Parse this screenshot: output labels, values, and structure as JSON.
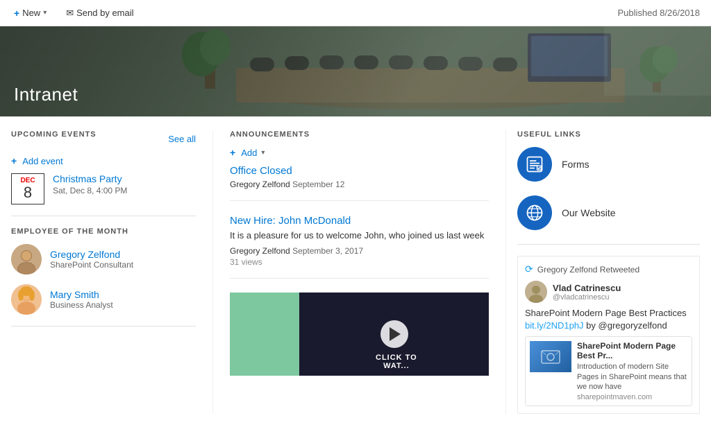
{
  "toolbar": {
    "new_label": "New",
    "send_email_label": "Send by email",
    "published_label": "Published 8/26/2018"
  },
  "hero": {
    "title": "Intranet"
  },
  "upcoming_events": {
    "section_title": "UPCOMING EVENTS",
    "see_all_label": "See all",
    "add_event_label": "+ Add event",
    "events": [
      {
        "month": "DEC",
        "day": "8",
        "name": "Christmas Party",
        "time": "Sat, Dec 8, 4:00 PM"
      }
    ]
  },
  "employee_of_month": {
    "section_title": "EMPLOYEE OF THE MONTH",
    "employees": [
      {
        "name": "Gregory Zelfond",
        "title": "SharePoint Consultant",
        "avatar": "gregory"
      },
      {
        "name": "Mary Smith",
        "title": "Business Analyst",
        "avatar": "mary"
      }
    ]
  },
  "announcements": {
    "section_title": "ANNOUNCEMENTS",
    "add_label": "Add",
    "items": [
      {
        "title": "Office Closed",
        "body": "",
        "author": "Gregory Zelfond",
        "date": "September 12",
        "views": ""
      },
      {
        "title": "New Hire: John McDonald",
        "body": "It is a pleasure for us to welcome John, who joined us last week",
        "author": "Gregory Zelfond",
        "date": "September 3, 2017",
        "views": "31 views"
      }
    ]
  },
  "useful_links": {
    "section_title": "USEFUL LINKS",
    "links": [
      {
        "label": "Forms",
        "icon": "forms"
      },
      {
        "label": "Our Website",
        "icon": "globe"
      }
    ]
  },
  "twitter": {
    "retweeted_by": "Gregory Zelfond Retweeted",
    "user_name": "Vlad Catrinescu",
    "user_handle": "@vladcatrinescu",
    "tweet_text": "SharePoint Modern Page Best Practices",
    "tweet_link": "bit.ly/2ND1phJ",
    "tweet_by": "by @gregoryzelfond",
    "card_title": "SharePoint Modern Page Best Pr...",
    "card_desc": "Introduction of modern Site Pages in SharePoint means that we now have",
    "card_domain": "sharepointmaven.com"
  }
}
